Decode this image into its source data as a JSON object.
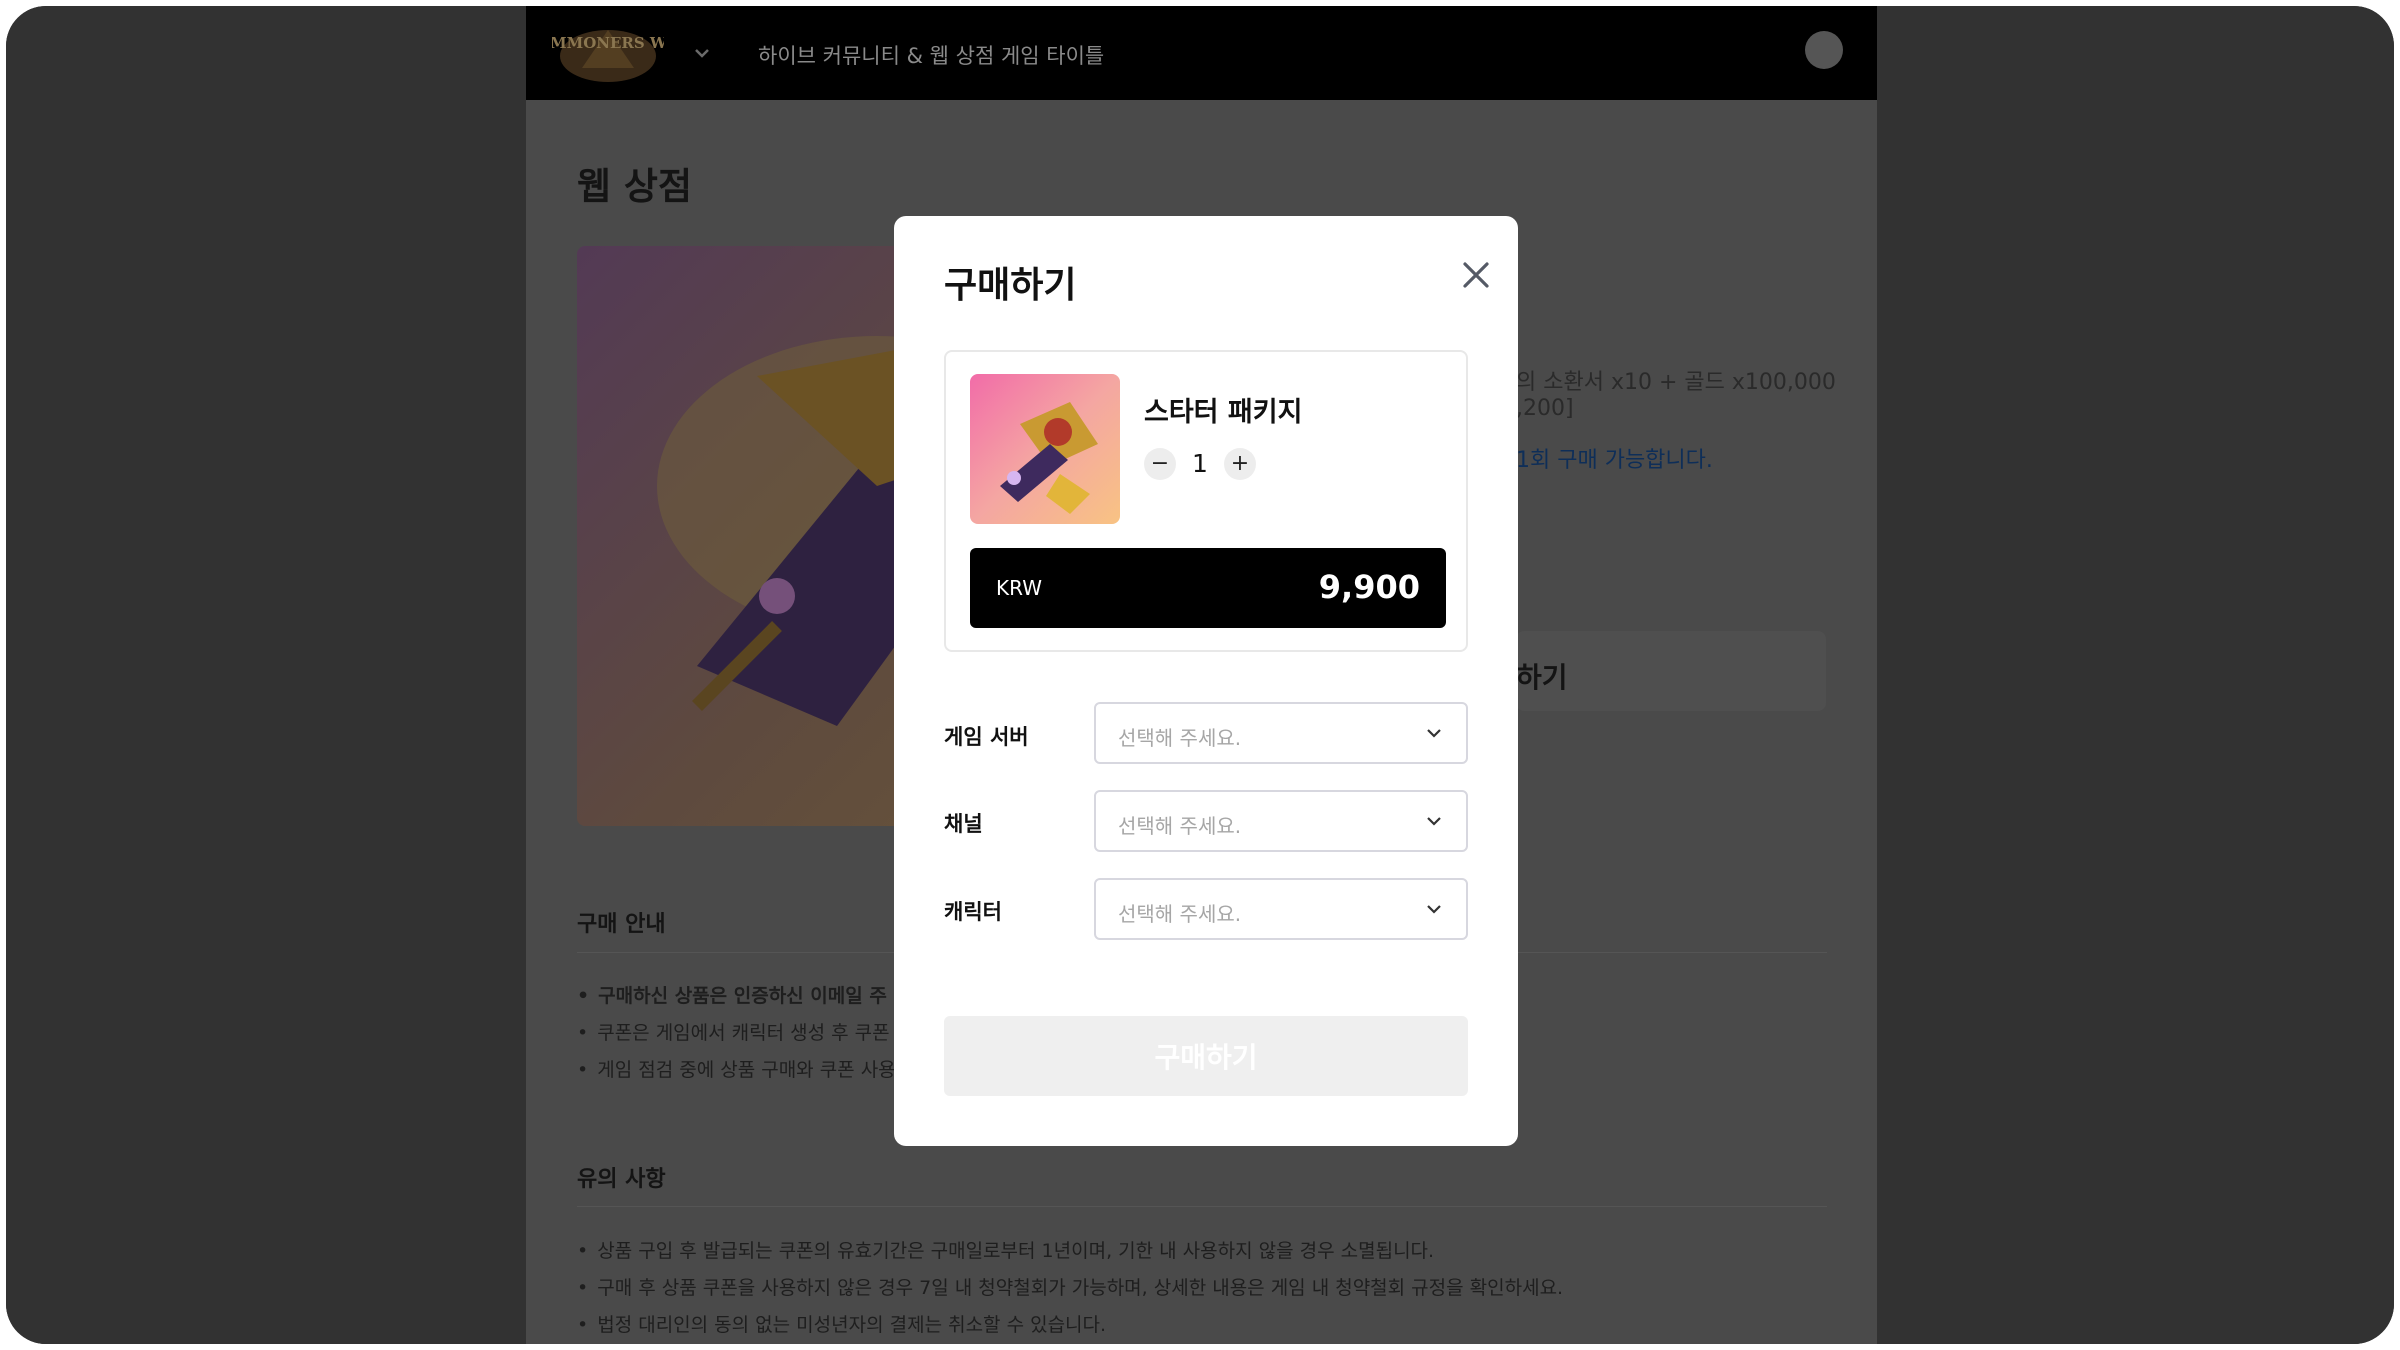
{
  "header": {
    "title": "하이브 커뮤니티 & 웹 상점 게임 타이틀",
    "logo_text": "SUMMONERS WAR"
  },
  "page": {
    "title": "웹 상점",
    "product_desc_line1": "의 소환서 x10 + 골드 x100,000",
    "product_desc_line2": ",200]",
    "product_limit": "1회 구매 가능합니다.",
    "buy_button_label": "하기"
  },
  "purchase_guide": {
    "title": "구매 안내",
    "items": [
      "구매하신 상품은 인증하신 이메일 주",
      "쿠폰은 게임에서 캐릭터 생성 후 쿠폰",
      "게임 점검 중에 상품 구매와 쿠폰 사용"
    ]
  },
  "notes": {
    "title": "유의 사항",
    "items": [
      "상품 구입 후 발급되는 쿠폰의 유효기간은 구매일로부터 1년이며, 기한 내 사용하지 않을 경우 소멸됩니다.",
      "구매 후 상품 쿠폰을 사용하지 않은 경우 7일 내 청약철회가 가능하며, 상세한 내용은 게임 내 청약철회 규정을 확인하세요.",
      "법정 대리인의 동의 없는 미성년자의 결제는 취소할 수 있습니다."
    ]
  },
  "modal": {
    "title": "구매하기",
    "item": {
      "name": "스타터 패키지",
      "quantity": "1",
      "minus": "−",
      "plus": "+"
    },
    "price": {
      "currency": "KRW",
      "amount": "9,900"
    },
    "fields": {
      "server": {
        "label": "게임 서버",
        "placeholder": "선택해 주세요."
      },
      "channel": {
        "label": "채널",
        "placeholder": "선택해 주세요."
      },
      "character": {
        "label": "캐릭터",
        "placeholder": "선택해 주세요."
      }
    },
    "buy_label": "구매하기"
  },
  "colors": {
    "overlay_dark": "#3a3a3a",
    "topbar": "#000000",
    "price_bar": "#000000",
    "limit_text": "#0e2e58",
    "disabled_button": "#efefef"
  },
  "icons": [
    "summoners-war-logo",
    "chevron-down-icon",
    "avatar",
    "close-icon",
    "minus-icon",
    "plus-icon"
  ]
}
